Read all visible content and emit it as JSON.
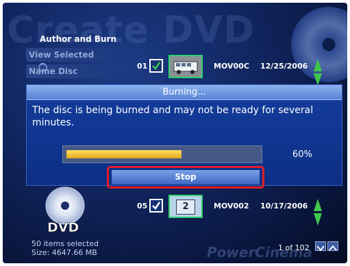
{
  "app": {
    "watermark_title": "Create DVD",
    "brand": "PowerCinema"
  },
  "sidebar": {
    "title": "Author and Burn",
    "items": [
      {
        "label": "View Selected"
      },
      {
        "label": "Name Disc"
      }
    ]
  },
  "rows": [
    {
      "num": "01",
      "checked": true,
      "file": "MOV00C",
      "date": "12/25/2006",
      "thumb": "bus-thumbnail"
    },
    {
      "num": "05",
      "checked": true,
      "file": "MOV002",
      "date": "10/17/2006",
      "thumb_label": "2"
    }
  ],
  "dialog": {
    "title": "Burning...",
    "message": "The disc is being burned and may not be ready for several minutes.",
    "progress_percent": 60,
    "progress_text": "60%",
    "stop_label": "Stop"
  },
  "footer": {
    "items_selected": "50 items selected",
    "size": "Size: 4647.66 MB",
    "page": "1 of 102",
    "dvd_label": "DVD"
  },
  "colors": {
    "accent": "#e21d24",
    "progress": "#f5c838",
    "check": "#3fc64a"
  }
}
